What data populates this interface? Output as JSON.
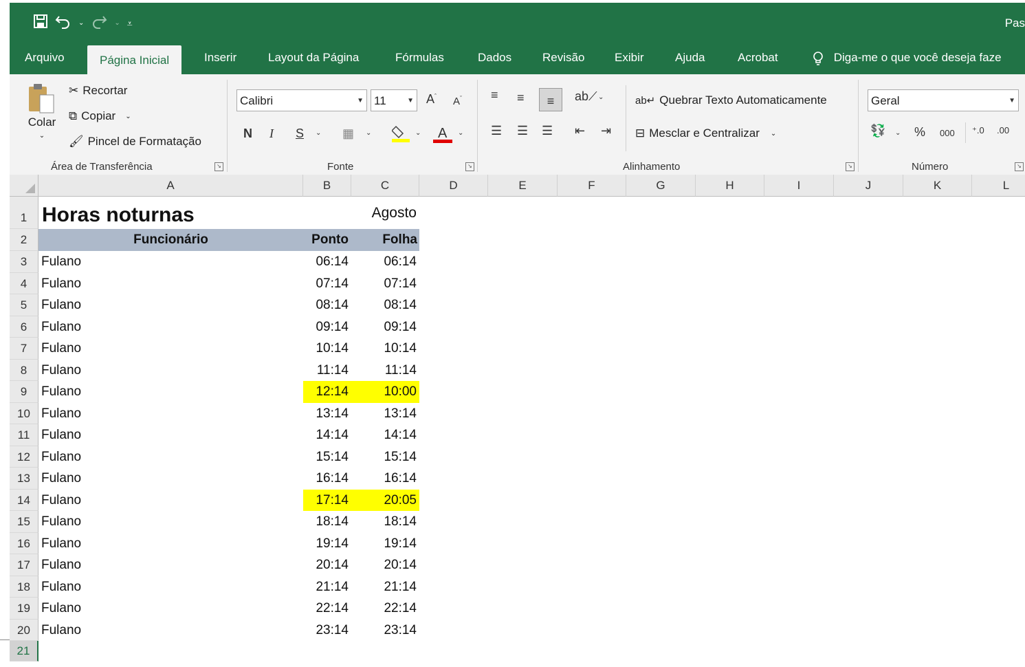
{
  "quick_access": {
    "save_icon": "save-icon",
    "undo_icon": "undo-icon",
    "redo_icon": "redo-icon",
    "customize_icon": "customize-qat-icon"
  },
  "title_partial": "Pas",
  "tabs": [
    {
      "label": "Arquivo"
    },
    {
      "label": "Página Inicial"
    },
    {
      "label": "Inserir"
    },
    {
      "label": "Layout da Página"
    },
    {
      "label": "Fórmulas"
    },
    {
      "label": "Dados"
    },
    {
      "label": "Revisão"
    },
    {
      "label": "Exibir"
    },
    {
      "label": "Ajuda"
    },
    {
      "label": "Acrobat"
    }
  ],
  "tell_me": "Diga-me o que você deseja faze",
  "ribbon": {
    "clipboard": {
      "paste": "Colar",
      "cut": "Recortar",
      "copy": "Copiar",
      "format_painter": "Pincel de Formatação",
      "label": "Área de Transferência"
    },
    "font": {
      "name": "Calibri",
      "size": "11",
      "bold": "N",
      "italic": "I",
      "underline": "S",
      "label": "Fonte"
    },
    "alignment": {
      "wrap": "Quebrar Texto Automaticamente",
      "merge": "Mesclar e Centralizar",
      "label": "Alinhamento"
    },
    "number": {
      "format": "Geral",
      "percent": "%",
      "thousands": "000",
      "label": "Número"
    }
  },
  "columns": [
    "A",
    "B",
    "C",
    "D",
    "E",
    "F",
    "G",
    "H",
    "I",
    "J",
    "K",
    "L"
  ],
  "sheet": {
    "title": "Horas noturnas",
    "month": "Agosto",
    "headers": {
      "employee": "Funcionário",
      "ponto": "Ponto",
      "folha": "Folha"
    },
    "rows": [
      {
        "name": "Fulano",
        "ponto": "06:14",
        "folha": "06:14",
        "highlight": false
      },
      {
        "name": "Fulano",
        "ponto": "07:14",
        "folha": "07:14",
        "highlight": false
      },
      {
        "name": "Fulano",
        "ponto": "08:14",
        "folha": "08:14",
        "highlight": false
      },
      {
        "name": "Fulano",
        "ponto": "09:14",
        "folha": "09:14",
        "highlight": false
      },
      {
        "name": "Fulano",
        "ponto": "10:14",
        "folha": "10:14",
        "highlight": false
      },
      {
        "name": "Fulano",
        "ponto": "11:14",
        "folha": "11:14",
        "highlight": false
      },
      {
        "name": "Fulano",
        "ponto": "12:14",
        "folha": "10:00",
        "highlight": true
      },
      {
        "name": "Fulano",
        "ponto": "13:14",
        "folha": "13:14",
        "highlight": false
      },
      {
        "name": "Fulano",
        "ponto": "14:14",
        "folha": "14:14",
        "highlight": false
      },
      {
        "name": "Fulano",
        "ponto": "15:14",
        "folha": "15:14",
        "highlight": false
      },
      {
        "name": "Fulano",
        "ponto": "16:14",
        "folha": "16:14",
        "highlight": false
      },
      {
        "name": "Fulano",
        "ponto": "17:14",
        "folha": "20:05",
        "highlight": true
      },
      {
        "name": "Fulano",
        "ponto": "18:14",
        "folha": "18:14",
        "highlight": false
      },
      {
        "name": "Fulano",
        "ponto": "19:14",
        "folha": "19:14",
        "highlight": false
      },
      {
        "name": "Fulano",
        "ponto": "20:14",
        "folha": "20:14",
        "highlight": false
      },
      {
        "name": "Fulano",
        "ponto": "21:14",
        "folha": "21:14",
        "highlight": false
      },
      {
        "name": "Fulano",
        "ponto": "22:14",
        "folha": "22:14",
        "highlight": false
      },
      {
        "name": "Fulano",
        "ponto": "23:14",
        "folha": "23:14",
        "highlight": false
      }
    ],
    "row_numbers": [
      "1",
      "2",
      "3",
      "4",
      "5",
      "6",
      "7",
      "8",
      "9",
      "10",
      "11",
      "12",
      "13",
      "14",
      "15",
      "16",
      "17",
      "18",
      "19",
      "20",
      "21"
    ],
    "selected_row": "21"
  },
  "colors": {
    "excel_green": "#217346",
    "highlight": "#ffff00",
    "header_band": "#adb9ca"
  }
}
